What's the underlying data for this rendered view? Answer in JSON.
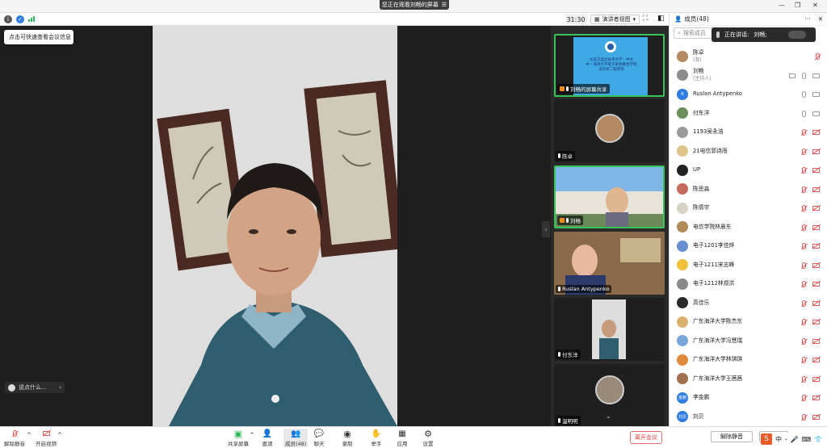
{
  "banner": {
    "text": "您正在观看刘畅的屏幕",
    "icon": "view-options-icon"
  },
  "toolbar2": {
    "timer": "31:30",
    "view_label": "演讲者视图",
    "info_tooltip": "点击可快速查看会议信息"
  },
  "chat": {
    "placeholder": "说点什么..."
  },
  "gallery": [
    {
      "name": "刘畅的屏幕共享",
      "kind": "screen",
      "slide_lines": [
        "大武王国立技术大学・中文",
        "中・海洋大学电子系统联合学院",
        "夫妇考二程开院"
      ]
    },
    {
      "name": "陈卓",
      "kind": "avatar"
    },
    {
      "name": "刘畅",
      "kind": "campus"
    },
    {
      "name": "Ruslan Antypenko",
      "kind": "office"
    },
    {
      "name": "付东洋",
      "kind": "portrait"
    },
    {
      "name": "温明明",
      "kind": "avatar"
    }
  ],
  "panel": {
    "title": "成员(48)",
    "search_placeholder": "搜索成员",
    "speaking_prefix": "正在讲话:",
    "speaking_name": "刘畅;",
    "members": [
      {
        "name": "陈卓",
        "role": "(我)",
        "avatar_color": "#b48a62",
        "avatar_text": "",
        "mic": "off",
        "cam": "none"
      },
      {
        "name": "刘畅",
        "role": "(主持人)",
        "avatar_color": "#8c8c8c",
        "avatar_text": "",
        "mic": "on",
        "cam": "on",
        "share": true
      },
      {
        "name": "Ruslan Antypenko",
        "role": "",
        "avatar_color": "#2f7de1",
        "avatar_text": "R",
        "mic": "on",
        "cam": "on"
      },
      {
        "name": "付东洋",
        "role": "",
        "avatar_color": "#6b8e5a",
        "avatar_text": "",
        "mic": "on",
        "cam": "on"
      },
      {
        "name": "1193吴永浩",
        "role": "",
        "avatar_color": "#9a9a9a",
        "avatar_text": "",
        "mic": "off",
        "cam": "off"
      },
      {
        "name": "21电信郭诗雨",
        "role": "",
        "avatar_color": "#e0c48a",
        "avatar_text": "",
        "mic": "off",
        "cam": "off"
      },
      {
        "name": "UP",
        "role": "",
        "avatar_color": "#222222",
        "avatar_text": "",
        "mic": "off",
        "cam": "off"
      },
      {
        "name": "陈思淼",
        "role": "",
        "avatar_color": "#c76a5c",
        "avatar_text": "",
        "mic": "off",
        "cam": "off"
      },
      {
        "name": "陈倩宇",
        "role": "",
        "avatar_color": "#d8d2c4",
        "avatar_text": "",
        "mic": "off",
        "cam": "off"
      },
      {
        "name": "电信学院林晨东",
        "role": "",
        "avatar_color": "#b08a58",
        "avatar_text": "",
        "mic": "off",
        "cam": "off"
      },
      {
        "name": "电子1201李佳烨",
        "role": "",
        "avatar_color": "#6a8fd0",
        "avatar_text": "",
        "mic": "off",
        "cam": "off"
      },
      {
        "name": "电子1211宋志峰",
        "role": "",
        "avatar_color": "#f0c03a",
        "avatar_text": "",
        "mic": "off",
        "cam": "off"
      },
      {
        "name": "电子1212林煜洪",
        "role": "",
        "avatar_color": "#8a8a8a",
        "avatar_text": "",
        "mic": "off",
        "cam": "off"
      },
      {
        "name": "高佳乐",
        "role": "",
        "avatar_color": "#2a2a2a",
        "avatar_text": "",
        "mic": "off",
        "cam": "off"
      },
      {
        "name": "广东海洋大学陈杰东",
        "role": "",
        "avatar_color": "#d9b070",
        "avatar_text": "",
        "mic": "off",
        "cam": "off"
      },
      {
        "name": "广东海洋大学冯慧瑞",
        "role": "",
        "avatar_color": "#7aa5d8",
        "avatar_text": "",
        "mic": "off",
        "cam": "off"
      },
      {
        "name": "广东海洋大学林琪琪",
        "role": "",
        "avatar_color": "#e08a3c",
        "avatar_text": "",
        "mic": "off",
        "cam": "off"
      },
      {
        "name": "广东海洋大学王茜茜",
        "role": "",
        "avatar_color": "#a07050",
        "avatar_text": "",
        "mic": "off",
        "cam": "off"
      },
      {
        "name": "李金鹏",
        "role": "",
        "avatar_color": "#2f7de1",
        "avatar_text": "金鹏",
        "mic": "off",
        "cam": "off"
      },
      {
        "name": "刘贝",
        "role": "",
        "avatar_color": "#2f7de1",
        "avatar_text": "刘贝",
        "mic": "off",
        "cam": "off"
      }
    ]
  },
  "bottombar": {
    "unmute": "解除静音",
    "start_video": "开启视频",
    "share": "共享屏幕",
    "invite": "邀请",
    "members": "成员(48)",
    "chat": "聊天",
    "record": "录制",
    "raise_hand": "举手",
    "apps": "应用",
    "settings": "设置",
    "leave": "离开会议"
  },
  "panel_bottom": {
    "unmute_all": "解除静音",
    "more": "更多"
  },
  "colors": {
    "accent_green": "#35c35a",
    "leave_red": "#e03c3c",
    "mute_red": "#e05a5a",
    "blue": "#2f7de1"
  }
}
